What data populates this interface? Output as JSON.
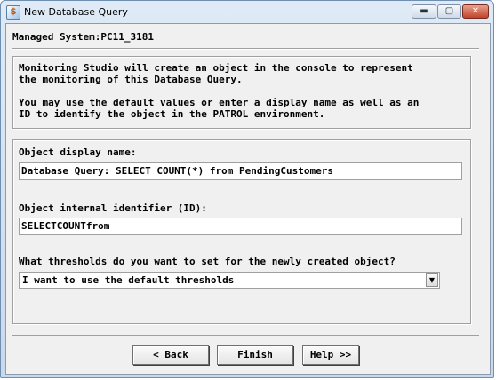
{
  "window": {
    "title": "New Database Query",
    "icon": "app-icon",
    "controls": {
      "minimize": "▬",
      "maximize": "▢",
      "close": "✕"
    }
  },
  "managed_system": "Managed System:PC11_3181",
  "intro": {
    "line1": "Monitoring Studio will create an object in the console to represent",
    "line2": "the monitoring of this Database Query.",
    "line3": "You may use the default values or enter a display name as well as an",
    "line4": "ID to identify the object in the PATROL environment."
  },
  "form": {
    "display_name_label": "Object display name:",
    "display_name_value": "Database Query: SELECT COUNT(*) from PendingCustomers",
    "id_label": "Object internal identifier (ID):",
    "id_value": "SELECTCOUNTfrom",
    "thresholds_label": "What thresholds do you want to set for the newly created object?",
    "thresholds_value": "I want to use the default thresholds",
    "thresholds_arrow": "▼"
  },
  "buttons": {
    "back": "< Back",
    "finish": "Finish",
    "help": "Help >>"
  }
}
